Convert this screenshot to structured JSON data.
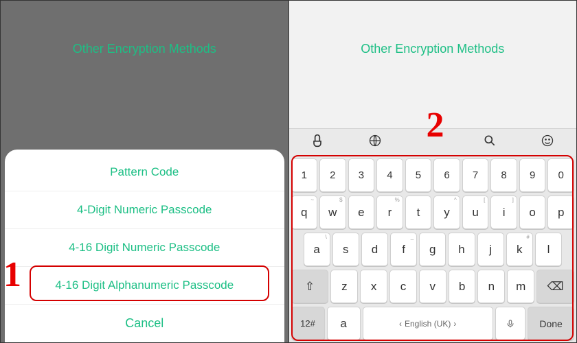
{
  "left": {
    "header": "Other Encryption Methods",
    "options": {
      "pattern": "Pattern Code",
      "numeric4": "4-Digit Numeric Passcode",
      "numeric416": "4-16 Digit Numeric Passcode",
      "alpha416": "4-16 Digit Alphanumeric Passcode",
      "cancel": "Cancel"
    },
    "step": "1"
  },
  "right": {
    "header": "Other Encryption Methods",
    "step": "2",
    "toolbar": {
      "touchpal": "TouchPal",
      "globe": "globe",
      "search": "search",
      "smiley": "smiley"
    },
    "keyboard": {
      "row_num": [
        "1",
        "2",
        "3",
        "4",
        "5",
        "6",
        "7",
        "8",
        "9",
        "0"
      ],
      "row1": [
        "q",
        "w",
        "e",
        "r",
        "t",
        "y",
        "u",
        "i",
        "o",
        "p"
      ],
      "row1_hints": [
        "~",
        "$",
        "",
        "%",
        "",
        "^",
        "[",
        "]",
        "",
        ""
      ],
      "row2": [
        "a",
        "s",
        "d",
        "f",
        "g",
        "h",
        "j",
        "k",
        "l"
      ],
      "row2_hints": [
        "\\",
        "",
        "",
        "_",
        "",
        "",
        "",
        "#",
        ""
      ],
      "shift": "⇧",
      "row3": [
        "z",
        "x",
        "c",
        "v",
        "b",
        "n",
        "m"
      ],
      "backspace": "⌫",
      "sym": "12#",
      "lang": "a",
      "space": "English (UK)",
      "mic": "🎤",
      "done": "Done"
    }
  }
}
